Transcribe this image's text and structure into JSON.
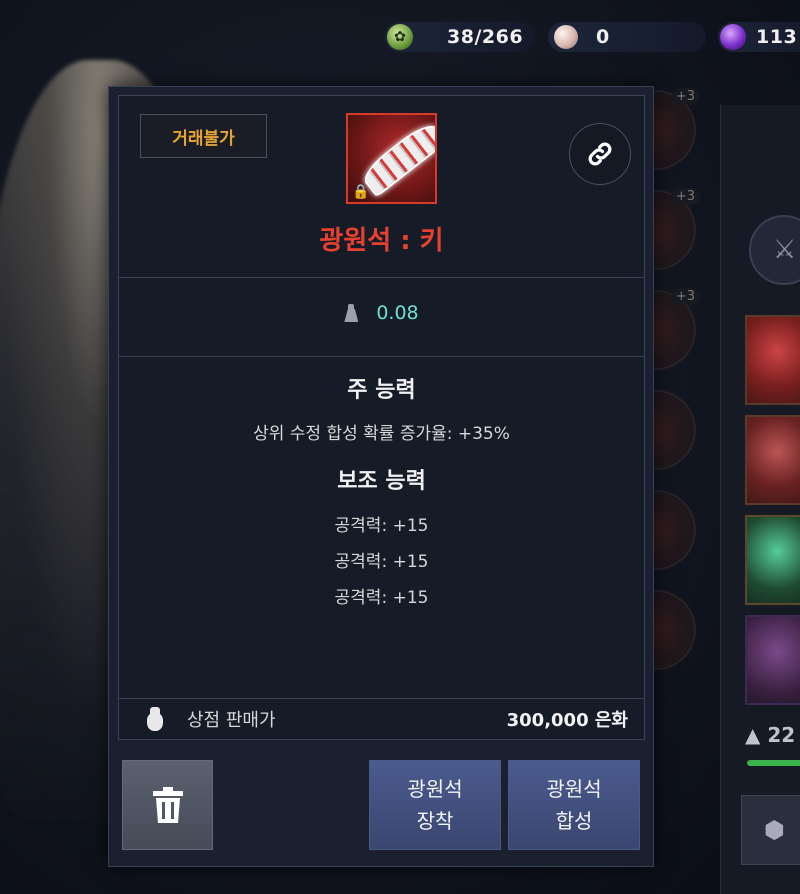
{
  "currencies": [
    {
      "icon": "green-crest-icon",
      "value": "38/266"
    },
    {
      "icon": "pearl-icon",
      "value": "0"
    },
    {
      "icon": "purple-orb-icon",
      "value": "113"
    }
  ],
  "tooltip": {
    "trade_badge": "거래불가",
    "item_name": "광원석 : 키",
    "item_name_color": "#e8412e",
    "weight": "0.08",
    "main_ability_title": "주 능력",
    "main_ability_stat": "상위 수정 합성 확률 증가율: +35%",
    "sub_ability_title": "보조 능력",
    "sub_ability_stats": [
      "공격력: +15",
      "공격력: +15",
      "공격력: +15"
    ],
    "shop_price_label": "상점 판매가",
    "shop_price_value": "300,000 은화"
  },
  "buttons": {
    "equip_line1": "광원석",
    "equip_line2": "장착",
    "synth_line1": "광원석",
    "synth_line2": "합성"
  },
  "background": {
    "slot_badge": "+3",
    "inventory_weight": "22"
  }
}
